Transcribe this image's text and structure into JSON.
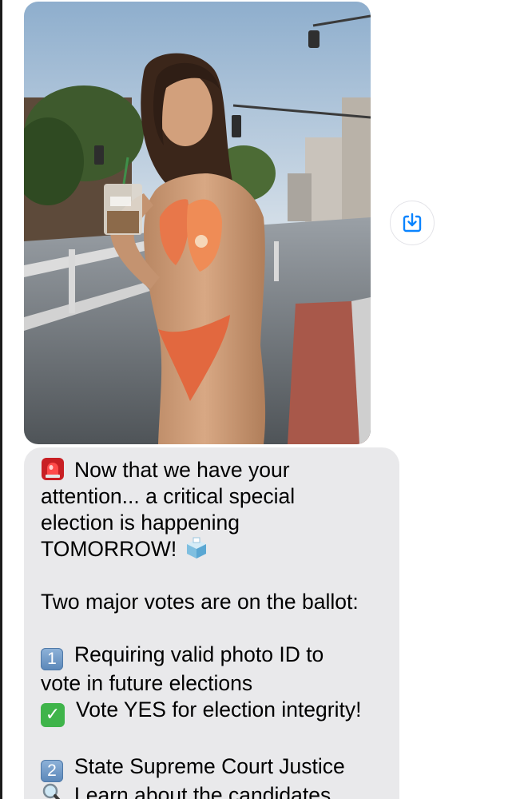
{
  "conversation": {
    "message": {
      "line1": "Now that we have your",
      "line2": "attention... a critical special",
      "line3": "election is happening",
      "line4": "TOMORROW!",
      "line5": "Two major votes are on the ballot:",
      "item1_line1": "Requiring valid photo ID to",
      "item1_line2": "vote in future elections",
      "item1_line3": "Vote YES for election integrity!",
      "item2_line1": "State Supreme Court Justice",
      "item2_line2": "Learn about the candidates",
      "keycap1": "1",
      "keycap2": "2",
      "checkmark": "✓"
    },
    "icons": {
      "alert": "rotating-light-icon",
      "ballot": "ballot-box-icon",
      "check": "check-mark-icon",
      "search": "magnifying-glass-icon",
      "save": "save-download-icon"
    }
  },
  "colors": {
    "bubble_bg": "#e9e9eb",
    "accent": "#0a84ff",
    "check_green": "#3fb44a",
    "keycap_blue": "#6b93c2",
    "alert_red": "#e0282b"
  }
}
